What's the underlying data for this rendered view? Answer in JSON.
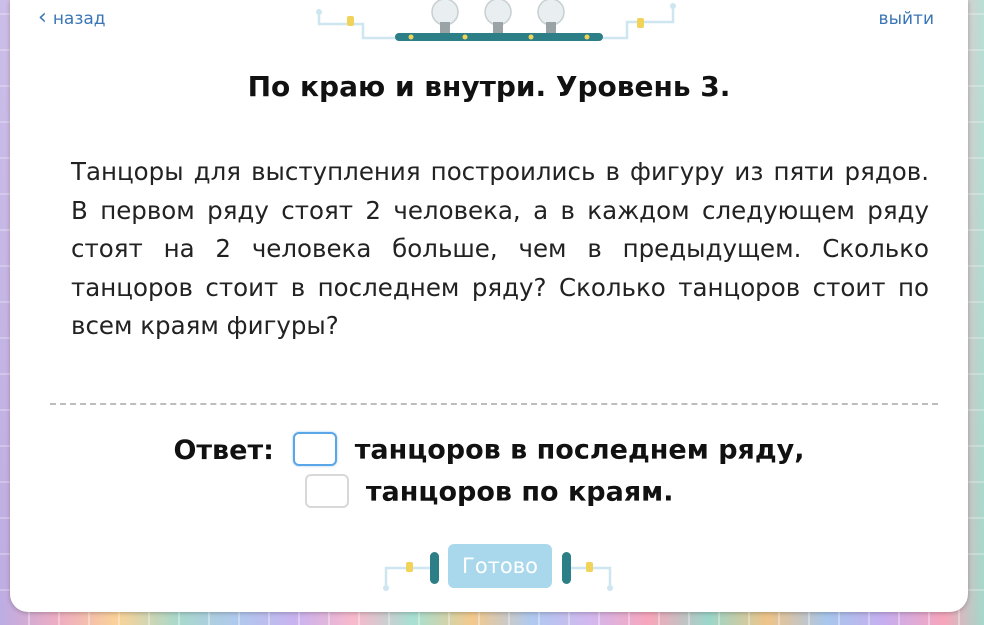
{
  "nav": {
    "back_label": "назад",
    "exit_label": "выйти"
  },
  "title": "По краю и внутри. Уровень 3.",
  "problem_text": "Танцоры для выступления построились в фигуру из пяти рядов. В первом ряду стоят 2 человека, а в каждом следующем ряду стоят на 2 человека больше, чем в предыдущем. Сколько танцоров стоит в последнем ряду? Сколько танцоров стоит по всем краям фигуры?",
  "answer": {
    "label": "Ответ:",
    "field1_value": "",
    "field1_text": "танцоров в последнем ряду,",
    "field2_value": "",
    "field2_text": "танцоров по краям."
  },
  "done_button": "Готово",
  "colors": {
    "link": "#3a76b6",
    "button_disabled": "#a9d8ec",
    "deco_teal": "#2c7f86",
    "input_focus": "#5aa6e6"
  },
  "icons": {
    "back": "chevron-left-icon",
    "bulbs": "light-bulb-icon",
    "circuit": "circuit-wire-icon"
  }
}
